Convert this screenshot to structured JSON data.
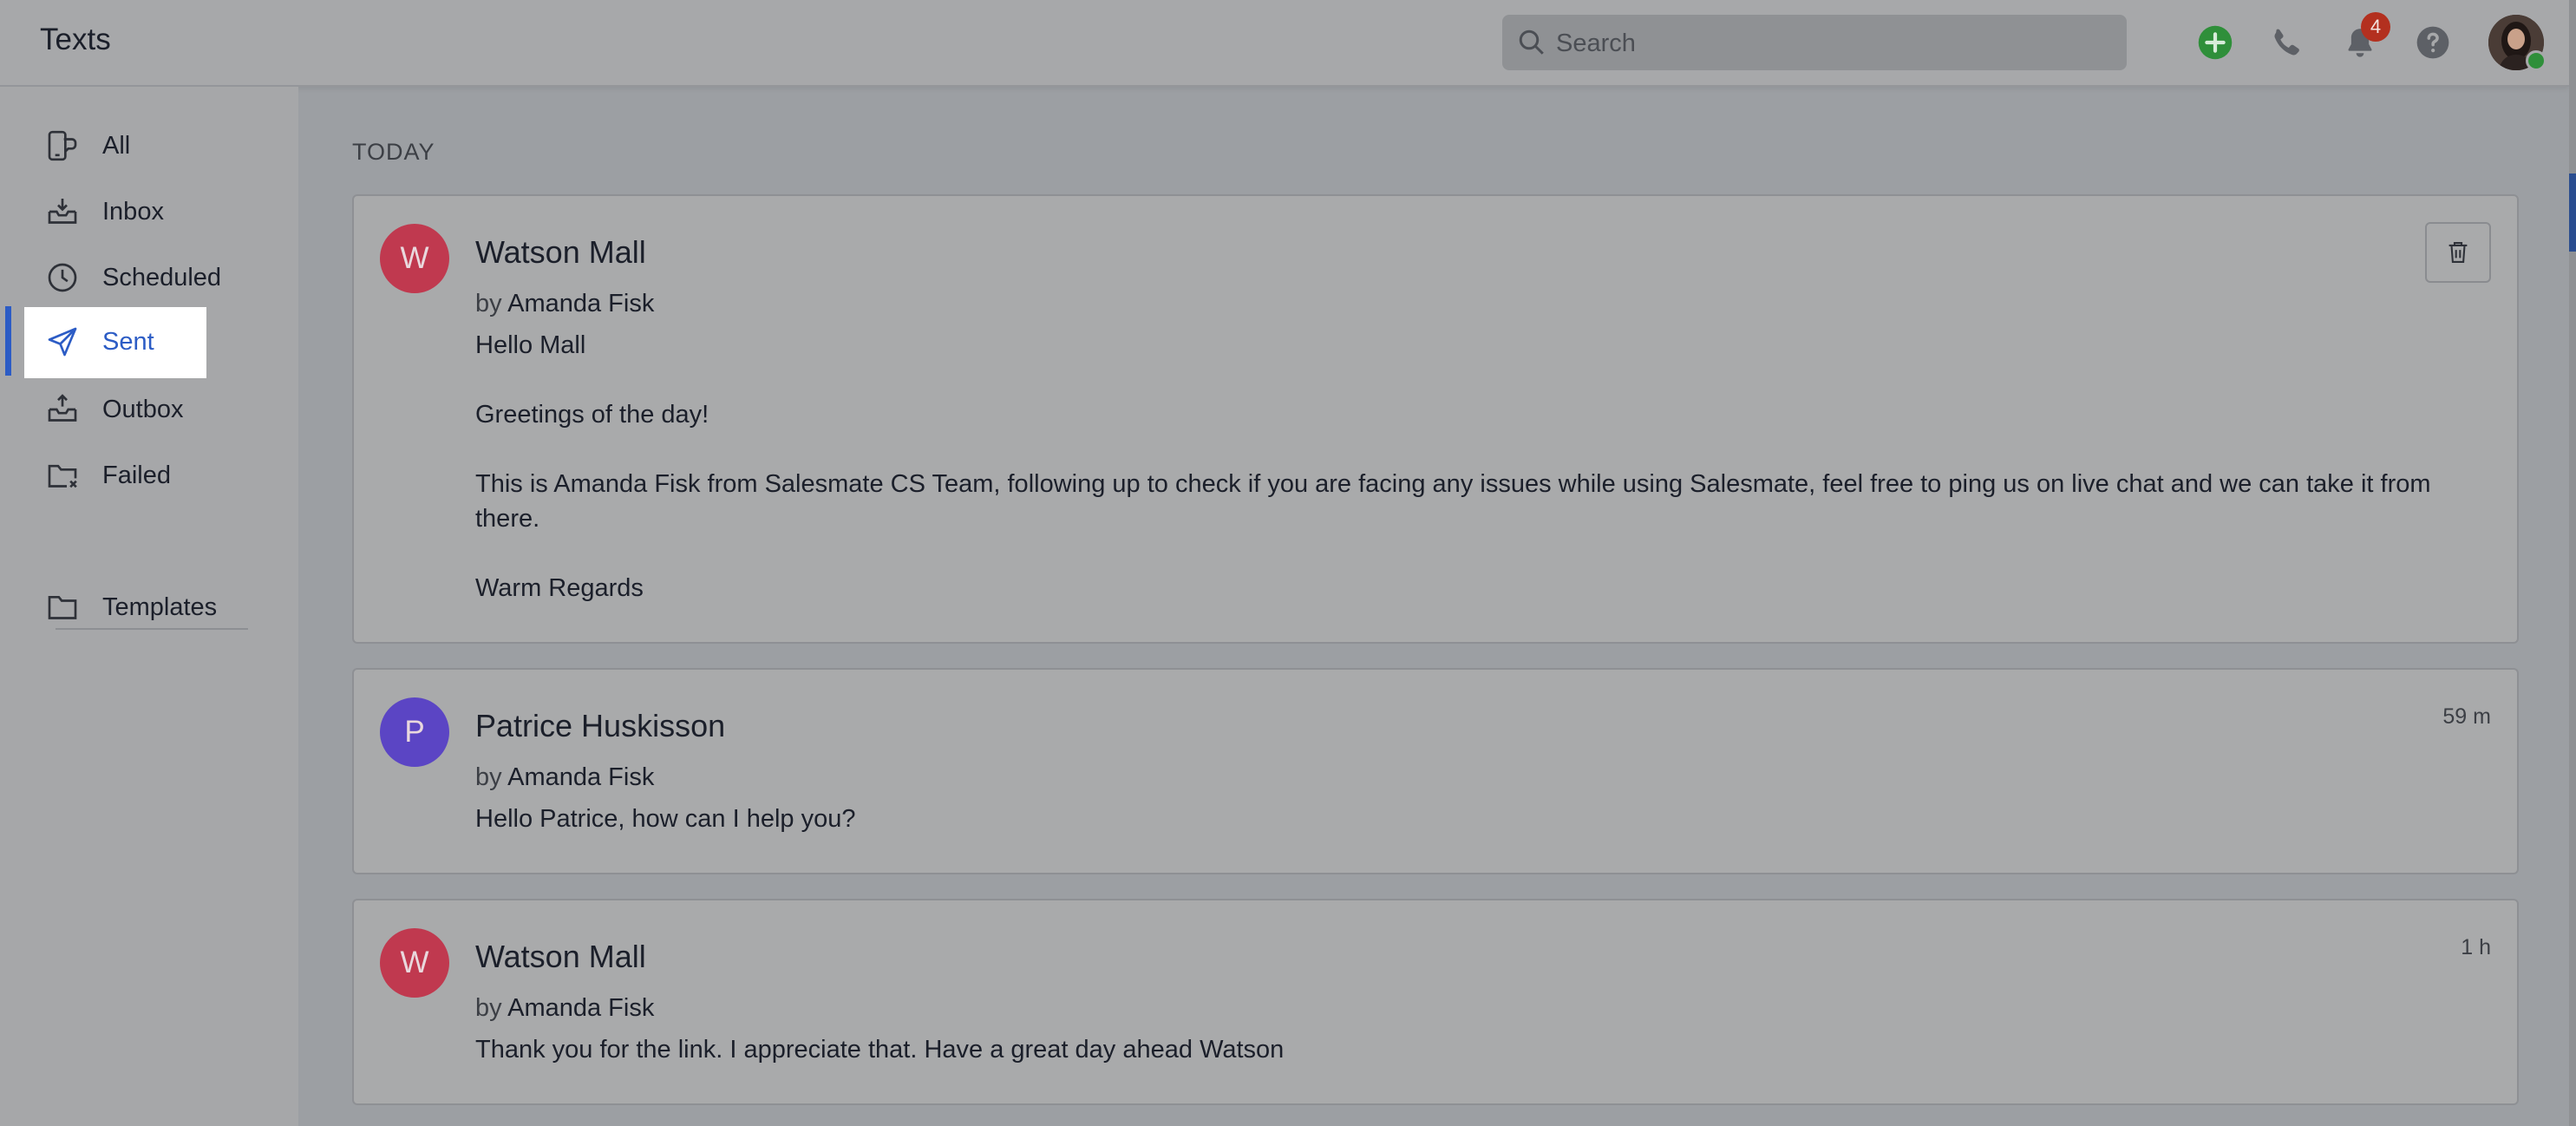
{
  "header": {
    "title": "Texts",
    "search_placeholder": "Search",
    "notification_count": "4",
    "icons": [
      "add-icon",
      "phone-icon",
      "bell-icon",
      "help-icon",
      "user-avatar"
    ],
    "accent_add": "#2f8f3a",
    "badge_color": "#b3301f"
  },
  "sidebar": {
    "items": [
      {
        "label": "All",
        "icon": "all-messages-icon"
      },
      {
        "label": "Inbox",
        "icon": "inbox-icon"
      },
      {
        "label": "Scheduled",
        "icon": "clock-icon"
      },
      {
        "label": "Sent",
        "icon": "send-icon",
        "active": true
      },
      {
        "label": "Outbox",
        "icon": "outbox-icon"
      },
      {
        "label": "Failed",
        "icon": "failed-icon"
      }
    ],
    "templates_label": "Templates",
    "active_color": "#2c5cc5"
  },
  "main": {
    "section_label": "TODAY",
    "messages": [
      {
        "initial": "W",
        "name": "Watson Mall",
        "by_prefix": "by",
        "author": "Amanda Fisk",
        "lines": [
          "Hello Mall",
          "Greetings of the day!",
          "This is Amanda Fisk from Salesmate CS Team, following up to check if you are facing any issues while using Salesmate, feel free to ping us on live chat and we can take it from there.",
          "Warm Regards"
        ],
        "time": "",
        "avatar_color": "#c0394f"
      },
      {
        "initial": "P",
        "name": "Patrice Huskisson",
        "by_prefix": "by",
        "author": "Amanda Fisk",
        "lines": [
          "Hello Patrice, how can I help you?"
        ],
        "time": "59 m",
        "avatar_color": "#5b45c4"
      },
      {
        "initial": "W",
        "name": "Watson Mall",
        "by_prefix": "by",
        "author": "Amanda Fisk",
        "lines": [
          "Thank you for the link. I appreciate that. Have a great day ahead Watson"
        ],
        "time": "1 h",
        "avatar_color": "#c0394f"
      }
    ]
  }
}
